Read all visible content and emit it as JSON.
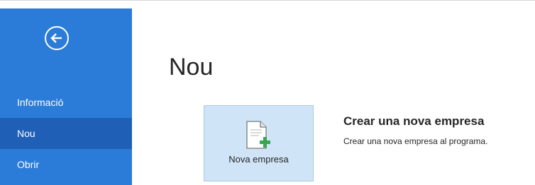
{
  "sidebar": {
    "back_icon": "back-arrow-icon",
    "items": [
      {
        "label": "Informació"
      },
      {
        "label": "Nou",
        "active": true
      },
      {
        "label": "Obrir"
      }
    ]
  },
  "main": {
    "title": "Nou",
    "tile": {
      "label": "Nova empresa",
      "icon": "new-document-plus-icon"
    },
    "description": {
      "title": "Crear una nova empresa",
      "text": "Crear una nova empresa al programa."
    }
  },
  "colors": {
    "sidebar": "#2b7cd8",
    "sidebar_active": "#1f5fb5",
    "tile_bg": "#cfe4f7",
    "plus": "#3aa552"
  }
}
